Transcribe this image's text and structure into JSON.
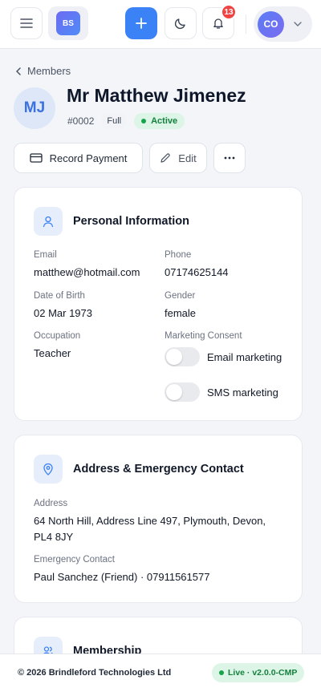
{
  "app": {
    "logo_text": "BS",
    "notifications_count": "13",
    "user_initials": "CO"
  },
  "breadcrumb": {
    "back_label": "Members"
  },
  "member": {
    "initials": "MJ",
    "name": "Mr Matthew Jimenez",
    "number": "#0002",
    "tier": "Full",
    "status": "Active"
  },
  "actions": {
    "record_payment": "Record Payment",
    "edit": "Edit"
  },
  "personal": {
    "title": "Personal Information",
    "email_label": "Email",
    "email": "matthew@hotmail.com",
    "phone_label": "Phone",
    "phone": "07174625144",
    "dob_label": "Date of Birth",
    "dob": "02 Mar 1973",
    "gender_label": "Gender",
    "gender": "female",
    "occupation_label": "Occupation",
    "occupation": "Teacher",
    "marketing_label": "Marketing Consent",
    "email_marketing_label": "Email marketing",
    "email_marketing_on": false,
    "sms_marketing_label": "SMS marketing",
    "sms_marketing_on": false
  },
  "address": {
    "title": "Address & Emergency Contact",
    "address_label": "Address",
    "address": "64 North Hill, Address Line 497, Plymouth, Devon, PL4 8JY",
    "emergency_label": "Emergency Contact",
    "emergency": "Paul Sanchez (Friend) · 07911561577"
  },
  "membership": {
    "title": "Membership"
  },
  "footer": {
    "copyright": "© 2026 Brindleford Technologies Ltd",
    "version": "Live · v2.0.0-CMP"
  },
  "colors": {
    "primary": "#3b82f6",
    "success": "#16a34a",
    "danger": "#ef4444"
  }
}
